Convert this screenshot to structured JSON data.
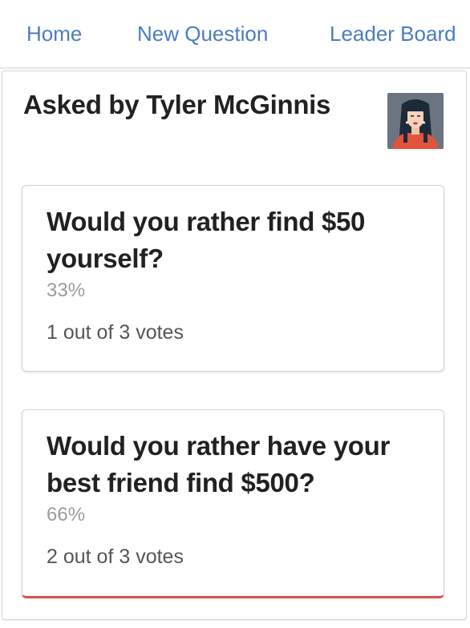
{
  "nav": {
    "home": "Home",
    "new_question": "New Question",
    "leader_board": "Leader Board"
  },
  "poll": {
    "asked_by": "Asked by Tyler McGinnis",
    "avatar_icon": "woman-avatar-icon",
    "options": [
      {
        "text": "Would you rather find $50 yourself?",
        "percent_label": "33%",
        "percent": 33,
        "votes_label": "1 out of 3 votes"
      },
      {
        "text": "Would you rather have your best friend find $500?",
        "percent_label": "66%",
        "percent": 66,
        "votes_label": "2 out of 3 votes"
      }
    ]
  },
  "colors": {
    "nav_link": "#4c7cc0",
    "selected_accent": "#d9534f"
  }
}
